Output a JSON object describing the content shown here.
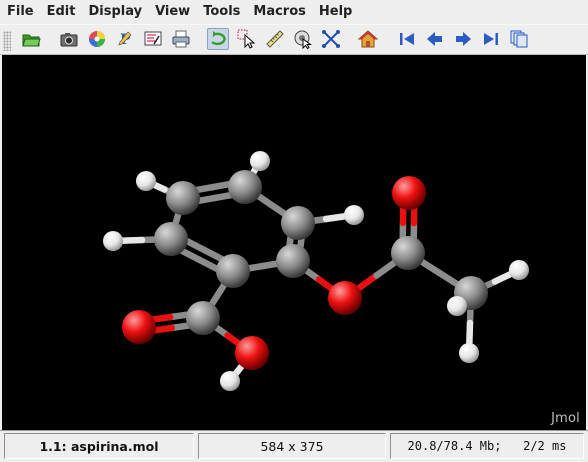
{
  "menu": [
    "File",
    "Edit",
    "Display",
    "View",
    "Tools",
    "Macros",
    "Help"
  ],
  "toolbar": {
    "buttons": [
      {
        "name": "open-folder-icon",
        "tooltip": ""
      },
      {
        "name": "camera-icon",
        "tooltip": ""
      },
      {
        "name": "color-wheel-icon",
        "tooltip": ""
      },
      {
        "name": "pencil-p-icon",
        "tooltip": ""
      },
      {
        "name": "console-icon",
        "tooltip": ""
      },
      {
        "name": "printer-icon",
        "tooltip": ""
      },
      {
        "name": "rotate-icon",
        "tooltip": "",
        "active": true
      },
      {
        "name": "pick-arrow-icon",
        "tooltip": ""
      },
      {
        "name": "ruler-icon",
        "tooltip": ""
      },
      {
        "name": "spin-pointer-icon",
        "tooltip": ""
      },
      {
        "name": "translate-cross-icon",
        "tooltip": ""
      },
      {
        "name": "home-icon",
        "tooltip": ""
      },
      {
        "name": "first-frame-icon",
        "tooltip": ""
      },
      {
        "name": "previous-frame-icon",
        "tooltip": ""
      },
      {
        "name": "next-frame-icon",
        "tooltip": ""
      },
      {
        "name": "last-frame-icon",
        "tooltip": ""
      },
      {
        "name": "copy-frames-icon",
        "tooltip": ""
      }
    ]
  },
  "viewer": {
    "background": "#000000",
    "logo_text": "Jmol"
  },
  "status": {
    "model": "1.1: aspirina.mol",
    "size": "584 x 375",
    "memory_timing": "20.8/78.4 Mb;   2/2 ms"
  },
  "colors": {
    "carbon": "#8c8c8c",
    "oxygen": "#ff0d0d",
    "hydrogen": "#f2f2f2"
  }
}
